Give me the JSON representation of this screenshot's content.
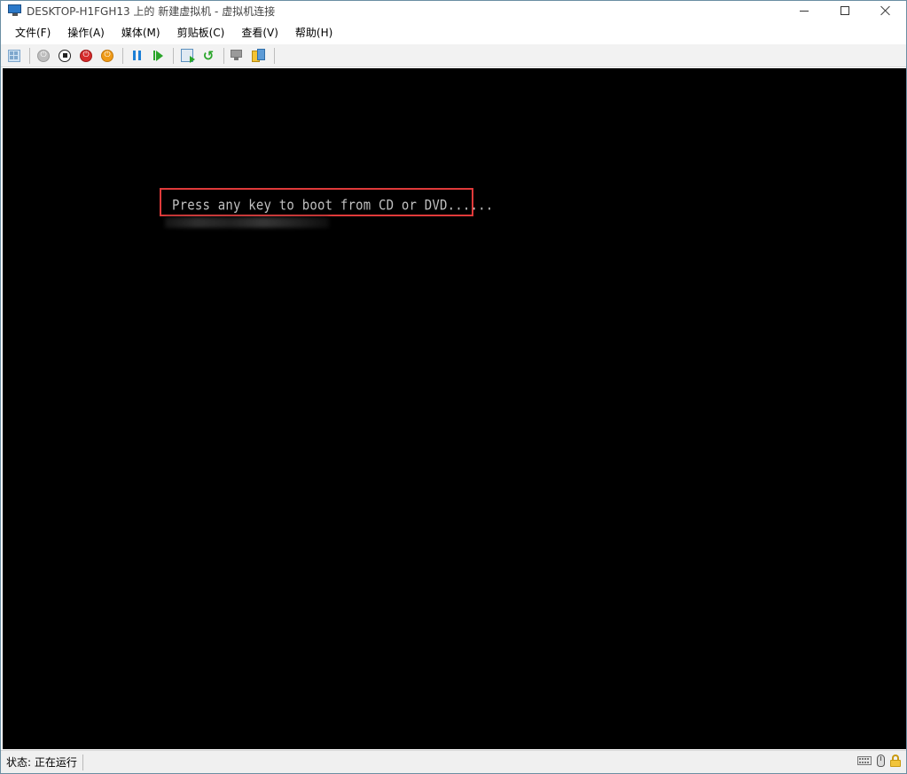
{
  "window": {
    "title": "DESKTOP-H1FGH13 上的 新建虚拟机 - 虚拟机连接",
    "icon": "vm-monitor-icon"
  },
  "menu": {
    "items": [
      {
        "label": "文件(F)"
      },
      {
        "label": "操作(A)"
      },
      {
        "label": "媒体(M)"
      },
      {
        "label": "剪贴板(C)"
      },
      {
        "label": "查看(V)"
      },
      {
        "label": "帮助(H)"
      }
    ]
  },
  "toolbar": {
    "buttons": [
      {
        "icon": "ctrl-alt-del-icon"
      },
      {
        "icon": "start-icon"
      },
      {
        "icon": "turn-off-icon"
      },
      {
        "icon": "shut-down-icon"
      },
      {
        "icon": "save-state-icon"
      },
      {
        "icon": "pause-icon"
      },
      {
        "icon": "resume-icon"
      },
      {
        "icon": "checkpoint-icon"
      },
      {
        "icon": "revert-icon"
      },
      {
        "icon": "enhanced-session-icon"
      },
      {
        "icon": "share-icon"
      }
    ]
  },
  "vm_screen": {
    "boot_message": "Press any key to boot from CD or DVD......"
  },
  "statusbar": {
    "status": "状态: 正在运行",
    "icons": [
      "keyboard-icon",
      "mouse-icon",
      "lock-icon"
    ]
  },
  "colors": {
    "highlight_box": "#e03a3a",
    "console_text": "#c0c0c0",
    "console_bg": "#000000"
  }
}
